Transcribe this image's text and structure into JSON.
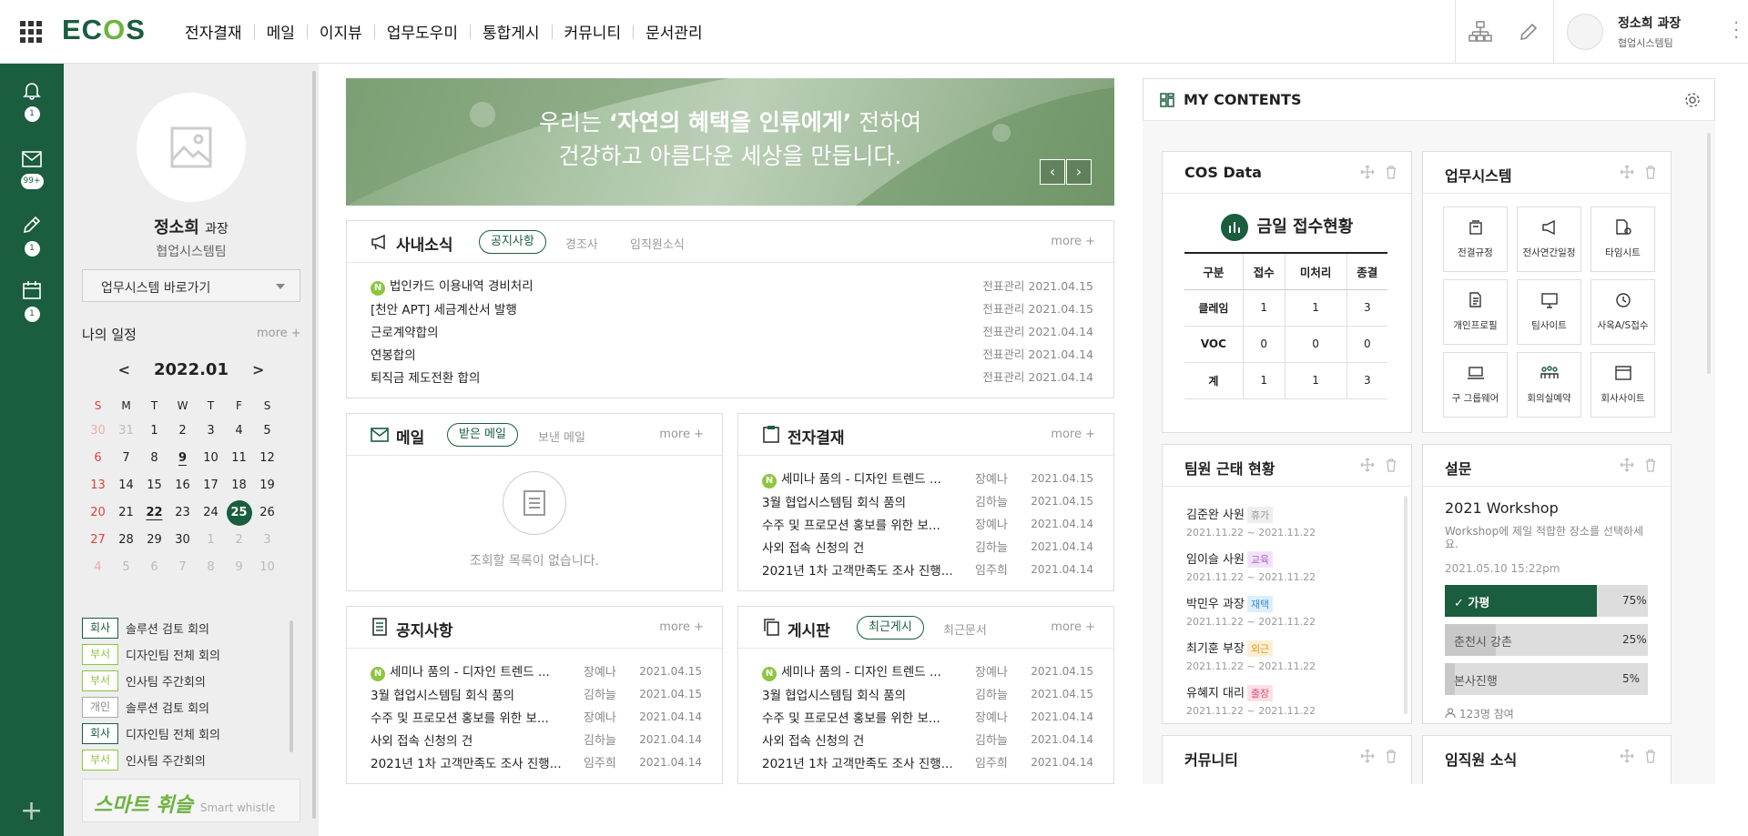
{
  "app": {
    "logo_left": "EC",
    "logo_mid": "O",
    "logo_right": "S"
  },
  "gnb": [
    "전자결재",
    "메일",
    "이지뷰",
    "업무도우미",
    "통합게시",
    "커뮤니티",
    "문서관리"
  ],
  "user": {
    "name": "정소희 과장",
    "dept": "협업시스템팀"
  },
  "leftbar": {
    "alarm_count": "1",
    "mail_count": "99+",
    "approval_count": "1",
    "calendar_count": "1"
  },
  "profile": {
    "name": "정소희",
    "title": "과장",
    "dept": "협업시스템팀",
    "shortcut": "업무시스템 바로가기",
    "schedule_title": "나의 일정",
    "more": "more +"
  },
  "calendar": {
    "month": "2022.01",
    "weekdays": [
      "S",
      "M",
      "T",
      "W",
      "T",
      "F",
      "S"
    ],
    "weeks": [
      [
        "30",
        "31",
        "1",
        "2",
        "3",
        "4",
        "5"
      ],
      [
        "6",
        "7",
        "8",
        "9",
        "10",
        "11",
        "12"
      ],
      [
        "13",
        "14",
        "15",
        "16",
        "17",
        "18",
        "19"
      ],
      [
        "20",
        "21",
        "22",
        "23",
        "24",
        "25",
        "26"
      ],
      [
        "27",
        "28",
        "29",
        "30",
        "1",
        "2",
        "3"
      ],
      [
        "4",
        "5",
        "6",
        "7",
        "8",
        "9",
        "10"
      ]
    ]
  },
  "schedules": [
    {
      "tag": "회사",
      "type": "company",
      "title": "솔루션 검토 회의"
    },
    {
      "tag": "부서",
      "type": "dept",
      "title": "디자인팀 전체 회의"
    },
    {
      "tag": "부서",
      "type": "dept",
      "title": "인사팀 주간회의"
    },
    {
      "tag": "개인",
      "type": "personal",
      "title": "솔루션 검토 회의"
    },
    {
      "tag": "회사",
      "type": "company",
      "title": "디자인팀 전체 회의"
    },
    {
      "tag": "부서",
      "type": "dept",
      "title": "인사팀 주간회의"
    }
  ],
  "whistle": {
    "title": "스마트 휘슬",
    "sub": "Smart whistle"
  },
  "banner": {
    "line1_pre": "우리는 ",
    "line1_bold": "‘자연의 혜택을 인류에게’",
    "line1_post": " 전하여",
    "line2": "건강하고 아름다운 세상을 만듭니다.",
    "prev": "‹",
    "next": "›"
  },
  "news": {
    "title": "사내소식",
    "tabs": [
      "공지사항",
      "경조사",
      "임직원소식"
    ],
    "more": "more +",
    "items": [
      {
        "new": true,
        "title": "법인카드 이용내역 경비처리",
        "cat": "전표관리",
        "date": "2021.04.15"
      },
      {
        "new": false,
        "title": "[천안 APT] 세금계산서 발행",
        "cat": "전표관리",
        "date": "2021.04.15"
      },
      {
        "new": false,
        "title": "근로계약합의",
        "cat": "전표관리",
        "date": "2021.04.14"
      },
      {
        "new": false,
        "title": "연봉합의",
        "cat": "전표관리",
        "date": "2021.04.14"
      },
      {
        "new": false,
        "title": "퇴직금 제도전환 합의",
        "cat": "전표관리",
        "date": "2021.04.14"
      }
    ]
  },
  "mail": {
    "title": "메일",
    "tabs": [
      "받은 메일",
      "보낸 메일"
    ],
    "more": "more +",
    "empty": "조회할 목록이 없습니다."
  },
  "approval": {
    "title": "전자결재",
    "more": "more +",
    "items": [
      {
        "new": true,
        "title": "세미나 품의 - 디자인 트렌드 ...",
        "author": "장예나",
        "date": "2021.04.15"
      },
      {
        "new": false,
        "title": "3월 협업시스템팀 회식 품의",
        "author": "김하늘",
        "date": "2021.04.15"
      },
      {
        "new": false,
        "title": "수주 및 프로모션 홍보를 위한 보...",
        "author": "장예나",
        "date": "2021.04.14"
      },
      {
        "new": false,
        "title": "사외 접속 신청의 건",
        "author": "김하늘",
        "date": "2021.04.14"
      },
      {
        "new": false,
        "title": "2021년 1차 고객만족도 조사 진행...",
        "author": "임주희",
        "date": "2021.04.14"
      }
    ]
  },
  "notice": {
    "title": "공지사항",
    "more": "more +",
    "items": [
      {
        "new": true,
        "title": "세미나 품의 - 디자인 트렌드 ...",
        "author": "장예나",
        "date": "2021.04.15"
      },
      {
        "new": false,
        "title": "3월 협업시스템팀 회식 품의",
        "author": "김하늘",
        "date": "2021.04.15"
      },
      {
        "new": false,
        "title": "수주 및 프로모션 홍보를 위한 보...",
        "author": "장예나",
        "date": "2021.04.14"
      },
      {
        "new": false,
        "title": "사외 접속 신청의 건",
        "author": "김하늘",
        "date": "2021.04.14"
      },
      {
        "new": false,
        "title": "2021년 1차 고객만족도 조사 진행...",
        "author": "임주희",
        "date": "2021.04.14"
      }
    ]
  },
  "board": {
    "title": "게시판",
    "tabs": [
      "최근게시",
      "최근문서"
    ],
    "more": "more +",
    "items": [
      {
        "new": true,
        "title": "세미나 품의 - 디자인 트렌드 ...",
        "author": "장예나",
        "date": "2021.04.15"
      },
      {
        "new": false,
        "title": "3월 협업시스템팀 회식 품의",
        "author": "김하늘",
        "date": "2021.04.15"
      },
      {
        "new": false,
        "title": "수주 및 프로모션 홍보를 위한 보...",
        "author": "장예나",
        "date": "2021.04.14"
      },
      {
        "new": false,
        "title": "사외 접속 신청의 건",
        "author": "김하늘",
        "date": "2021.04.14"
      },
      {
        "new": false,
        "title": "2021년 1차 고객만족도 조사 진행...",
        "author": "임주희",
        "date": "2021.04.14"
      }
    ]
  },
  "mycontents": {
    "title": "MY CONTENTS"
  },
  "cos": {
    "title": "COS Data",
    "subtitle": "금일 접수현황",
    "cols": [
      "구분",
      "접수",
      "미처리",
      "종결"
    ],
    "rows": [
      [
        "클레임",
        "1",
        "1",
        "3"
      ],
      [
        "VOC",
        "0",
        "0",
        "0"
      ],
      [
        "계",
        "1",
        "1",
        "3"
      ]
    ]
  },
  "systems": {
    "title": "업무시스템",
    "items": [
      "전결규정",
      "전사연간일정",
      "타임시트",
      "개인프로필",
      "팀사이트",
      "사옥A/S접수",
      "구 그룹웨어",
      "회의실예약",
      "회사사이트"
    ]
  },
  "attendance": {
    "title": "팀원 근태 현황",
    "items": [
      {
        "name": "김준완 사원",
        "tag": "휴가",
        "color": "#eeeeee",
        "tcolor": "#999",
        "period": "2021.11.22 ~ 2021.11.22"
      },
      {
        "name": "임이슬 사원",
        "tag": "교육",
        "color": "#f1e3f7",
        "tcolor": "#b35fd1",
        "period": "2021.11.22 ~ 2021.11.22"
      },
      {
        "name": "박민우 과장",
        "tag": "재택",
        "color": "#ddeefb",
        "tcolor": "#3b8ed8",
        "period": "2021.11.22 ~ 2021.11.22"
      },
      {
        "name": "최기훈 부장",
        "tag": "외근",
        "color": "#fcefd6",
        "tcolor": "#e09a1a",
        "period": "2021.11.22 ~ 2021.11.22"
      },
      {
        "name": "유혜지 대리",
        "tag": "출장",
        "color": "#fbe0e6",
        "tcolor": "#e0507a",
        "period": "2021.11.22 ~ 2021.11.22"
      }
    ]
  },
  "survey": {
    "title": "설문",
    "name": "2021 Workshop",
    "desc": "Workshop에 제일 적합한 장소를 선택하세요.",
    "date": "2021.05.10 15:22pm",
    "options": [
      {
        "label": "✓ 가평",
        "pct": "75%",
        "value": 75
      },
      {
        "label": "춘천시 강촌",
        "pct": "25%",
        "value": 25
      },
      {
        "label": "본사진행",
        "pct": "5%",
        "value": 5
      }
    ],
    "participants": "123명 참여"
  },
  "community": {
    "title": "커뮤니티"
  },
  "staffnews": {
    "title": "임직원 소식"
  },
  "colors": {
    "brand": "#1a5d3f",
    "accent": "#8cc63f"
  }
}
